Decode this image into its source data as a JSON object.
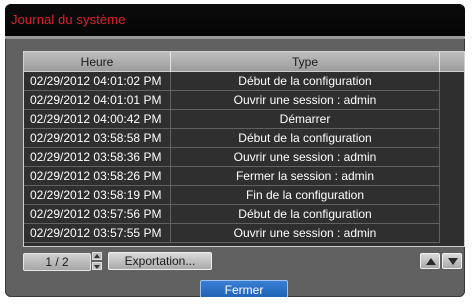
{
  "window": {
    "title": "Journal du système"
  },
  "table": {
    "columns": [
      "Heure",
      "Type"
    ],
    "rows": [
      {
        "time": "02/29/2012  04:01:02 PM",
        "type": "Début de la configuration"
      },
      {
        "time": "02/29/2012  04:01:01 PM",
        "type": "Ouvrir une session : admin"
      },
      {
        "time": "02/29/2012  04:00:42 PM",
        "type": "Démarrer"
      },
      {
        "time": "02/29/2012  03:58:58 PM",
        "type": "Début de la configuration"
      },
      {
        "time": "02/29/2012  03:58:36 PM",
        "type": "Ouvrir une session : admin"
      },
      {
        "time": "02/29/2012  03:58:26 PM",
        "type": "Fermer la session : admin"
      },
      {
        "time": "02/29/2012  03:58:19 PM",
        "type": "Fin de la configuration"
      },
      {
        "time": "02/29/2012  03:57:56 PM",
        "type": "Début de la configuration"
      },
      {
        "time": "02/29/2012  03:57:55 PM",
        "type": "Ouvrir une session : admin"
      }
    ]
  },
  "pager": {
    "page": "1 / 2"
  },
  "buttons": {
    "export": "Exportation...",
    "close": "Fermer"
  },
  "icons": {
    "spinner": "page-spinner-icon",
    "up": "arrow-up-icon",
    "down": "arrow-down-icon"
  },
  "colors": {
    "title": "#e0212a",
    "accent": "#1c5fb3",
    "panel": "#616161"
  }
}
